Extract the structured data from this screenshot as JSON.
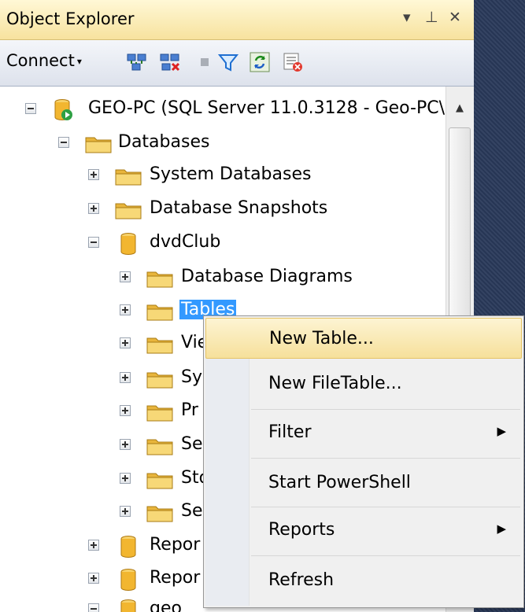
{
  "window": {
    "title": "Object Explorer",
    "controls": {
      "dropdown": "▾",
      "pin": "⊥",
      "close": "✕"
    }
  },
  "toolbar": {
    "connect_label": "Connect",
    "connect_arrow": "▾",
    "tools": [
      {
        "name": "connect-object-explorer-icon"
      },
      {
        "name": "disconnect-icon"
      },
      {
        "name": "stop-icon"
      },
      {
        "name": "filter-icon"
      },
      {
        "name": "refresh-icon"
      },
      {
        "name": "script-icon"
      }
    ]
  },
  "tree": {
    "server": {
      "label": "GEO-PC (SQL Server 11.0.3128 - Geo-PC\\"
    },
    "databases": {
      "label": "Databases"
    },
    "system_databases": {
      "label": "System Databases"
    },
    "database_snapshots": {
      "label": "Database Snapshots"
    },
    "dvdclub": {
      "label": "dvdClub"
    },
    "database_diagrams": {
      "label": "Database Diagrams"
    },
    "tables": {
      "label": "Tables"
    },
    "views": {
      "label": "Vie"
    },
    "synonyms": {
      "label": "Sy"
    },
    "programmability": {
      "label": "Pr"
    },
    "service_broker": {
      "label": "Se"
    },
    "storage": {
      "label": "Sto"
    },
    "security": {
      "label": "Se"
    },
    "report_server": {
      "label": "Repor"
    },
    "report_server_temp": {
      "label": "Repor"
    },
    "geo": {
      "label": "geo"
    }
  },
  "context_menu": {
    "new_table": "New Table...",
    "new_filetable": "New FileTable...",
    "filter": "Filter",
    "start_powershell": "Start PowerShell",
    "reports": "Reports",
    "refresh": "Refresh",
    "submenu_arrow": "▶"
  },
  "colors": {
    "title_bar": "#f7e29e",
    "selection": "#3399ff",
    "menu_hover": "#f6e09b",
    "folder": "#f2c94c",
    "database": "#f2b630",
    "desktop_background": "#2b3c59"
  }
}
